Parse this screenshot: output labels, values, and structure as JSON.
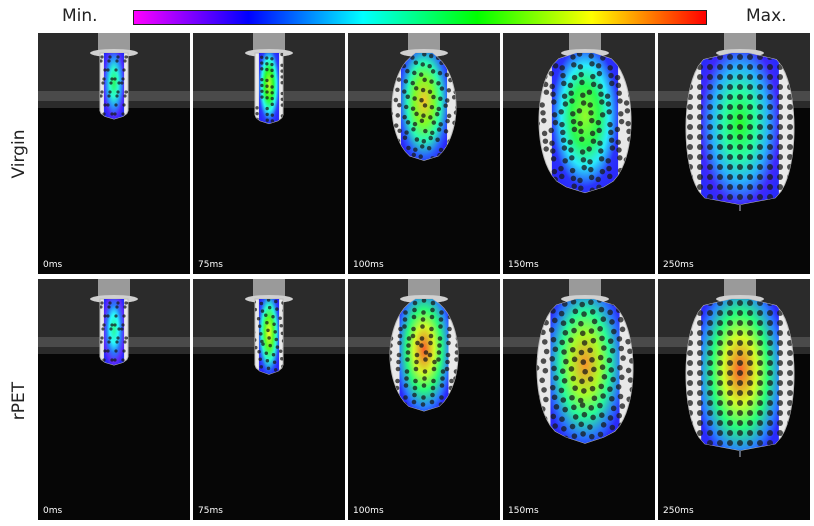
{
  "legend": {
    "min_label": "Min.",
    "max_label": "Max.",
    "colormap": [
      "#ff00ff",
      "#0000ff",
      "#00ffff",
      "#00ff00",
      "#ffff00",
      "#ff0000"
    ]
  },
  "rows": [
    {
      "label": "Virgin",
      "frames": [
        {
          "time": "0ms",
          "inflation": 0.0,
          "strain_level": 0.55
        },
        {
          "time": "75ms",
          "inflation": 0.05,
          "strain_level": 0.75
        },
        {
          "time": "100ms",
          "inflation": 0.45,
          "strain_level": 0.85
        },
        {
          "time": "150ms",
          "inflation": 0.8,
          "strain_level": 0.7
        },
        {
          "time": "250ms",
          "inflation": 1.0,
          "strain_level": 0.6
        }
      ]
    },
    {
      "label": "rPET",
      "frames": [
        {
          "time": "0ms",
          "inflation": 0.0,
          "strain_level": 0.5
        },
        {
          "time": "75ms",
          "inflation": 0.1,
          "strain_level": 0.8
        },
        {
          "time": "100ms",
          "inflation": 0.5,
          "strain_level": 0.95
        },
        {
          "time": "150ms",
          "inflation": 0.85,
          "strain_level": 0.9
        },
        {
          "time": "250ms",
          "inflation": 1.0,
          "strain_level": 0.95
        }
      ]
    }
  ]
}
